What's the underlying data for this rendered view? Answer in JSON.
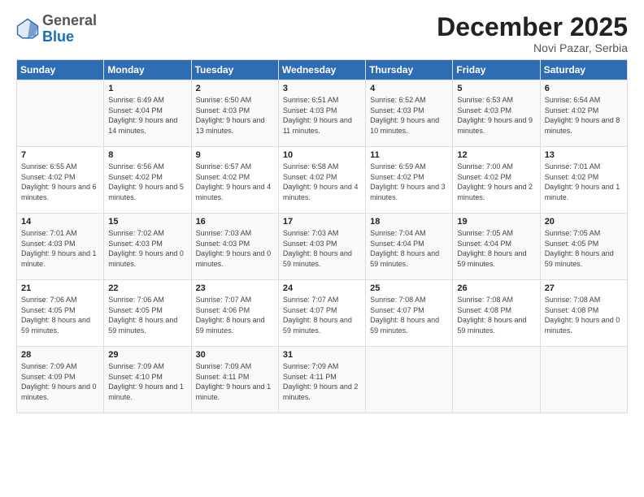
{
  "header": {
    "logo_general": "General",
    "logo_blue": "Blue",
    "month_title": "December 2025",
    "subtitle": "Novi Pazar, Serbia"
  },
  "days_of_week": [
    "Sunday",
    "Monday",
    "Tuesday",
    "Wednesday",
    "Thursday",
    "Friday",
    "Saturday"
  ],
  "weeks": [
    [
      {
        "day": "",
        "sunrise": "",
        "sunset": "",
        "daylight": ""
      },
      {
        "day": "1",
        "sunrise": "Sunrise: 6:49 AM",
        "sunset": "Sunset: 4:04 PM",
        "daylight": "Daylight: 9 hours and 14 minutes."
      },
      {
        "day": "2",
        "sunrise": "Sunrise: 6:50 AM",
        "sunset": "Sunset: 4:03 PM",
        "daylight": "Daylight: 9 hours and 13 minutes."
      },
      {
        "day": "3",
        "sunrise": "Sunrise: 6:51 AM",
        "sunset": "Sunset: 4:03 PM",
        "daylight": "Daylight: 9 hours and 11 minutes."
      },
      {
        "day": "4",
        "sunrise": "Sunrise: 6:52 AM",
        "sunset": "Sunset: 4:03 PM",
        "daylight": "Daylight: 9 hours and 10 minutes."
      },
      {
        "day": "5",
        "sunrise": "Sunrise: 6:53 AM",
        "sunset": "Sunset: 4:03 PM",
        "daylight": "Daylight: 9 hours and 9 minutes."
      },
      {
        "day": "6",
        "sunrise": "Sunrise: 6:54 AM",
        "sunset": "Sunset: 4:02 PM",
        "daylight": "Daylight: 9 hours and 8 minutes."
      }
    ],
    [
      {
        "day": "7",
        "sunrise": "Sunrise: 6:55 AM",
        "sunset": "Sunset: 4:02 PM",
        "daylight": "Daylight: 9 hours and 6 minutes."
      },
      {
        "day": "8",
        "sunrise": "Sunrise: 6:56 AM",
        "sunset": "Sunset: 4:02 PM",
        "daylight": "Daylight: 9 hours and 5 minutes."
      },
      {
        "day": "9",
        "sunrise": "Sunrise: 6:57 AM",
        "sunset": "Sunset: 4:02 PM",
        "daylight": "Daylight: 9 hours and 4 minutes."
      },
      {
        "day": "10",
        "sunrise": "Sunrise: 6:58 AM",
        "sunset": "Sunset: 4:02 PM",
        "daylight": "Daylight: 9 hours and 4 minutes."
      },
      {
        "day": "11",
        "sunrise": "Sunrise: 6:59 AM",
        "sunset": "Sunset: 4:02 PM",
        "daylight": "Daylight: 9 hours and 3 minutes."
      },
      {
        "day": "12",
        "sunrise": "Sunrise: 7:00 AM",
        "sunset": "Sunset: 4:02 PM",
        "daylight": "Daylight: 9 hours and 2 minutes."
      },
      {
        "day": "13",
        "sunrise": "Sunrise: 7:01 AM",
        "sunset": "Sunset: 4:02 PM",
        "daylight": "Daylight: 9 hours and 1 minute."
      }
    ],
    [
      {
        "day": "14",
        "sunrise": "Sunrise: 7:01 AM",
        "sunset": "Sunset: 4:03 PM",
        "daylight": "Daylight: 9 hours and 1 minute."
      },
      {
        "day": "15",
        "sunrise": "Sunrise: 7:02 AM",
        "sunset": "Sunset: 4:03 PM",
        "daylight": "Daylight: 9 hours and 0 minutes."
      },
      {
        "day": "16",
        "sunrise": "Sunrise: 7:03 AM",
        "sunset": "Sunset: 4:03 PM",
        "daylight": "Daylight: 9 hours and 0 minutes."
      },
      {
        "day": "17",
        "sunrise": "Sunrise: 7:03 AM",
        "sunset": "Sunset: 4:03 PM",
        "daylight": "Daylight: 8 hours and 59 minutes."
      },
      {
        "day": "18",
        "sunrise": "Sunrise: 7:04 AM",
        "sunset": "Sunset: 4:04 PM",
        "daylight": "Daylight: 8 hours and 59 minutes."
      },
      {
        "day": "19",
        "sunrise": "Sunrise: 7:05 AM",
        "sunset": "Sunset: 4:04 PM",
        "daylight": "Daylight: 8 hours and 59 minutes."
      },
      {
        "day": "20",
        "sunrise": "Sunrise: 7:05 AM",
        "sunset": "Sunset: 4:05 PM",
        "daylight": "Daylight: 8 hours and 59 minutes."
      }
    ],
    [
      {
        "day": "21",
        "sunrise": "Sunrise: 7:06 AM",
        "sunset": "Sunset: 4:05 PM",
        "daylight": "Daylight: 8 hours and 59 minutes."
      },
      {
        "day": "22",
        "sunrise": "Sunrise: 7:06 AM",
        "sunset": "Sunset: 4:05 PM",
        "daylight": "Daylight: 8 hours and 59 minutes."
      },
      {
        "day": "23",
        "sunrise": "Sunrise: 7:07 AM",
        "sunset": "Sunset: 4:06 PM",
        "daylight": "Daylight: 8 hours and 59 minutes."
      },
      {
        "day": "24",
        "sunrise": "Sunrise: 7:07 AM",
        "sunset": "Sunset: 4:07 PM",
        "daylight": "Daylight: 8 hours and 59 minutes."
      },
      {
        "day": "25",
        "sunrise": "Sunrise: 7:08 AM",
        "sunset": "Sunset: 4:07 PM",
        "daylight": "Daylight: 8 hours and 59 minutes."
      },
      {
        "day": "26",
        "sunrise": "Sunrise: 7:08 AM",
        "sunset": "Sunset: 4:08 PM",
        "daylight": "Daylight: 8 hours and 59 minutes."
      },
      {
        "day": "27",
        "sunrise": "Sunrise: 7:08 AM",
        "sunset": "Sunset: 4:08 PM",
        "daylight": "Daylight: 9 hours and 0 minutes."
      }
    ],
    [
      {
        "day": "28",
        "sunrise": "Sunrise: 7:09 AM",
        "sunset": "Sunset: 4:09 PM",
        "daylight": "Daylight: 9 hours and 0 minutes."
      },
      {
        "day": "29",
        "sunrise": "Sunrise: 7:09 AM",
        "sunset": "Sunset: 4:10 PM",
        "daylight": "Daylight: 9 hours and 1 minute."
      },
      {
        "day": "30",
        "sunrise": "Sunrise: 7:09 AM",
        "sunset": "Sunset: 4:11 PM",
        "daylight": "Daylight: 9 hours and 1 minute."
      },
      {
        "day": "31",
        "sunrise": "Sunrise: 7:09 AM",
        "sunset": "Sunset: 4:11 PM",
        "daylight": "Daylight: 9 hours and 2 minutes."
      },
      {
        "day": "",
        "sunrise": "",
        "sunset": "",
        "daylight": ""
      },
      {
        "day": "",
        "sunrise": "",
        "sunset": "",
        "daylight": ""
      },
      {
        "day": "",
        "sunrise": "",
        "sunset": "",
        "daylight": ""
      }
    ]
  ]
}
